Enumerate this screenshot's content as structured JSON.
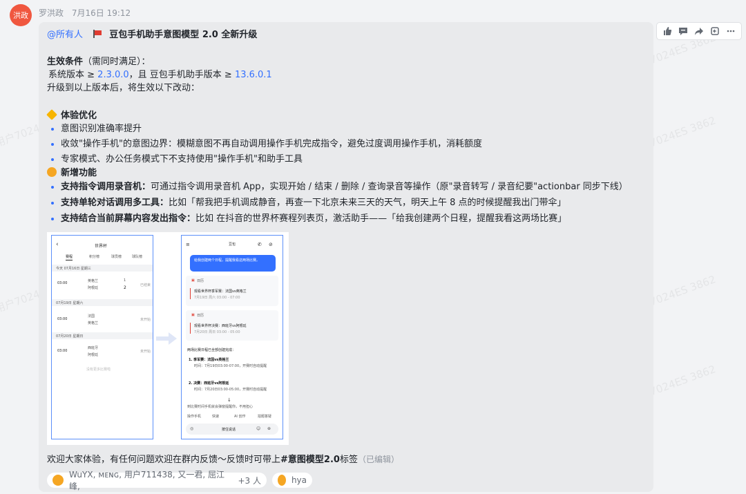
{
  "sender": {
    "avatar_text": "洪政",
    "name": "罗洪政",
    "time": "7月16日 19:12"
  },
  "actions": [
    "thumbs-up-icon",
    "comment-icon",
    "forward-icon",
    "reply-icon",
    "more-icon"
  ],
  "message": {
    "mention": "@所有人",
    "title": "豆包手机助手意图模型 2.0 全新升级",
    "cond_title": "生效条件",
    "cond_note": "（需同时满足）：",
    "version_pre": "系统版本 ≥ ",
    "version_sys": "2.3.0.0",
    "version_mid": "，且 豆包手机助手版本 ≥ ",
    "version_app": "13.6.0.1",
    "upgrade_note": "升级到以上版本后，将生效以下改动：",
    "section1_title": "体验优化",
    "section1_items": [
      "意图识别准确率提升",
      "收敛\"操作手机\"的意图边界：模糊意图不再自动调用操作手机完成指令，避免过度调用操作手机，消耗额度",
      "专家模式、办公任务模式下不支持使用\"操作手机\"和助手工具"
    ],
    "section2_title": "新增功能",
    "section2_items": [
      {
        "bold": "支持指令调用录音机：",
        "text": "可通过指令调用录音机 App，实现开始 / 结束 / 删除 / 查询录音等操作（原\"录音转写 / 录音纪要\"actionbar 同步下线）"
      },
      {
        "bold": "支持单轮对话调用多工具：",
        "text": "比如「帮我把手机调成静音，再查一下北京未来三天的天气，明天上午 8 点的时候提醒我出门带伞」"
      },
      {
        "bold": "支持结合当前屏幕内容发出指令：",
        "text": "比如 在抖音的世界杯赛程列表页，激活助手——「给我创建两个日程，提醒我看这两场比赛」"
      }
    ],
    "footer_text": "欢迎大家体验，有任何问题欢迎在群内反馈～反馈时可带上",
    "footer_tag": "#意图模型2.0",
    "footer_tail": "标签",
    "edited": "（已编辑）"
  },
  "screenshot_left": {
    "title": "世界杯",
    "tabs": [
      "赛程",
      "积分榜",
      "球员榜",
      "球队榜"
    ],
    "day1": "今天 07月16日 星期三",
    "m1_time": "03:00",
    "m1_t1": "英格兰",
    "m1_s1": "1",
    "m1_t2": "阿根廷",
    "m1_s2": "2",
    "m1_status": "已结束",
    "day2": "07月19日 星期六",
    "m2_time": "03:00",
    "m2_t1": "法国",
    "m2_t2": "英格兰",
    "m2_status": "未开始",
    "day3": "07月20日 星期日",
    "m3_time": "03:00",
    "m3_t1": "西班牙",
    "m3_t2": "阿根廷",
    "m3_status": "未开始",
    "more": "没有更多比赛啦"
  },
  "screenshot_right": {
    "title": "豆包",
    "user_msg": "给我创建两个日程，提醒我看这两场比赛。",
    "cal_label": "日历",
    "ev1": "观看世界杯季军赛：法国vs英格兰",
    "ev1_time": "7月19日 周六 03:00 - 07:00",
    "ev2": "观看世界杯决赛：西班牙vs阿根廷",
    "ev2_time": "7月20日 周日 03:00 - 05:00",
    "reply_head": "两场比赛日程已全部创建完成：",
    "r1": "1. 季军赛：法国vs英格兰",
    "r1_time": "时间：7月19日03:00-07:00，开赛时自动提醒",
    "r2": "2. 决赛：西班牙vs阿根廷",
    "r2_time": "时间：7月20日03:00-05:00，开赛时自动提醒",
    "r_tail": "到比赛时间手机就会弹窗提醒你，不用担心",
    "tools": [
      "操作手机",
      "快速",
      "AI 创作",
      "拍题答疑"
    ],
    "hold": "按住说话"
  },
  "reactions": [
    {
      "emoji": "thumbs-up-emoji",
      "users": "WuYX, ᴍᴇɴɢ, 用户711438, 又一君, 屈江峰,",
      "more": "+3 人"
    },
    {
      "emoji": "clap-emoji",
      "users": "hya"
    }
  ],
  "watermark": "飞书用户7024ES 3862",
  "colors": {
    "accent": "#3370ff",
    "avatar": "#f0573f",
    "bubble": "#e9eaec"
  }
}
